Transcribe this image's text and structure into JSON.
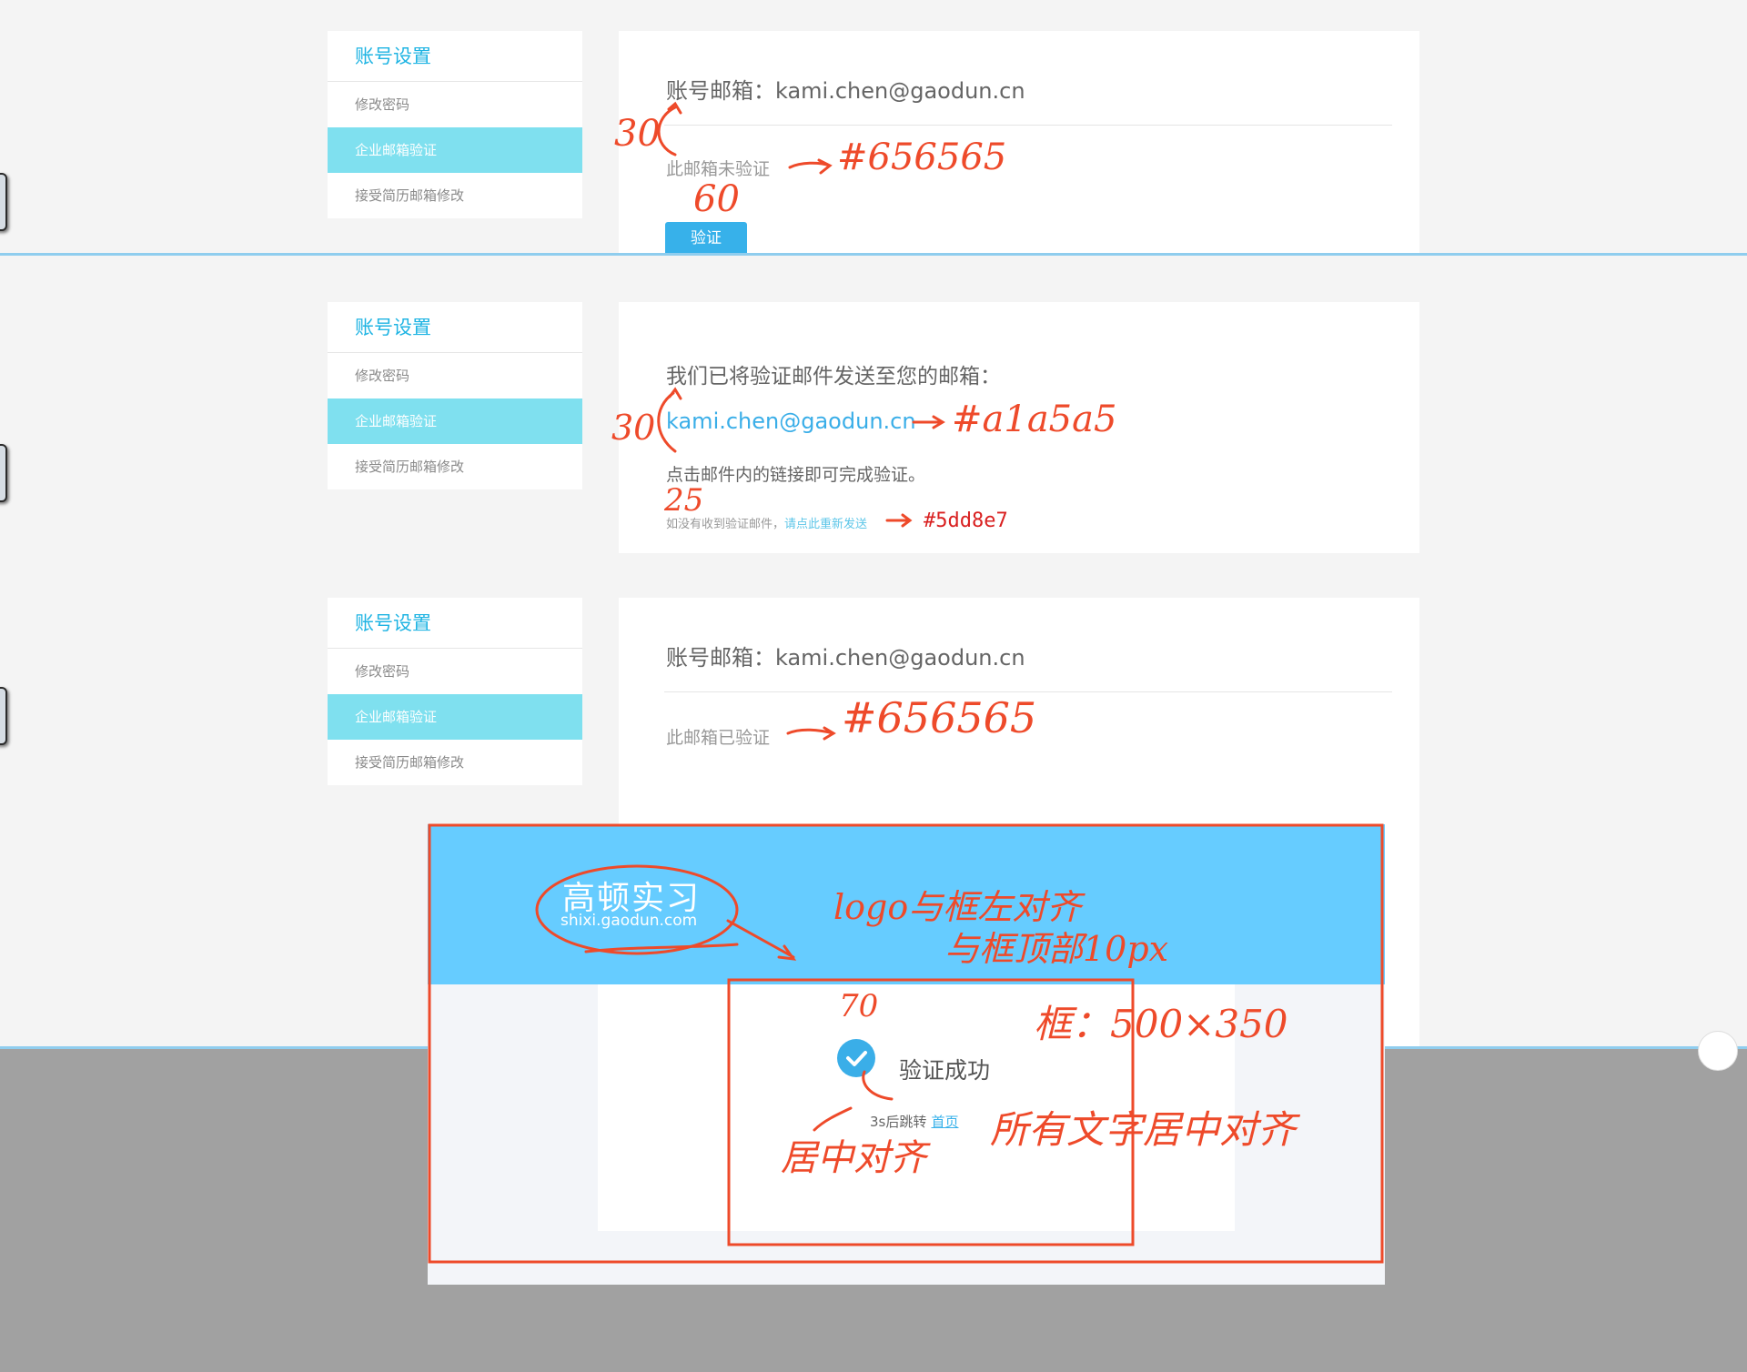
{
  "sidebar": {
    "title": "账号设置",
    "items": [
      {
        "label": "修改密码"
      },
      {
        "label": "企业邮箱验证"
      },
      {
        "label": "接受简历邮箱修改"
      }
    ]
  },
  "state_unverified": {
    "account_email": "账号邮箱：kami.chen@gaodun.cn",
    "status": "此邮箱未验证",
    "verify_button": "验证"
  },
  "state_sent": {
    "heading": "我们已将验证邮件发送至您的邮箱：",
    "email": "kami.chen@gaodun.cn",
    "instruction": "点击邮件内的链接即可完成验证。",
    "not_received": "如没有收到验证邮件，",
    "resend_link": "请点此重新发送"
  },
  "state_verified": {
    "account_email": "账号邮箱：kami.chen@gaodun.cn",
    "status": "此邮箱已验证"
  },
  "modal": {
    "logo_text": "高顿实习",
    "logo_url": "shixi.gaodun.com",
    "success_text": "验证成功",
    "redirect_text": "3s后跳转",
    "home_link": "首页"
  },
  "annotations": {
    "a1": "30",
    "a2": "#656565",
    "a3": "60",
    "a4": "30",
    "a5": "#a1a5a5",
    "a6": "25",
    "a7": "#5dd8e7",
    "a8": "#656565",
    "a9": "logo与框左对齐",
    "a10": "与框顶部10px",
    "a11": "70",
    "a12": "框：500×350",
    "a13": "居中对齐",
    "a14": "所有文字居中对齐"
  },
  "colors": {
    "accent_blue": "#37b1ea",
    "sidebar_active": "#7fe0ef",
    "sidebar_title": "#1fb4e3",
    "text_main": "#656565",
    "annotation_red": "#ee4a2a",
    "modal_header": "#66ccff"
  },
  "icons": [
    "check-circle-icon"
  ]
}
